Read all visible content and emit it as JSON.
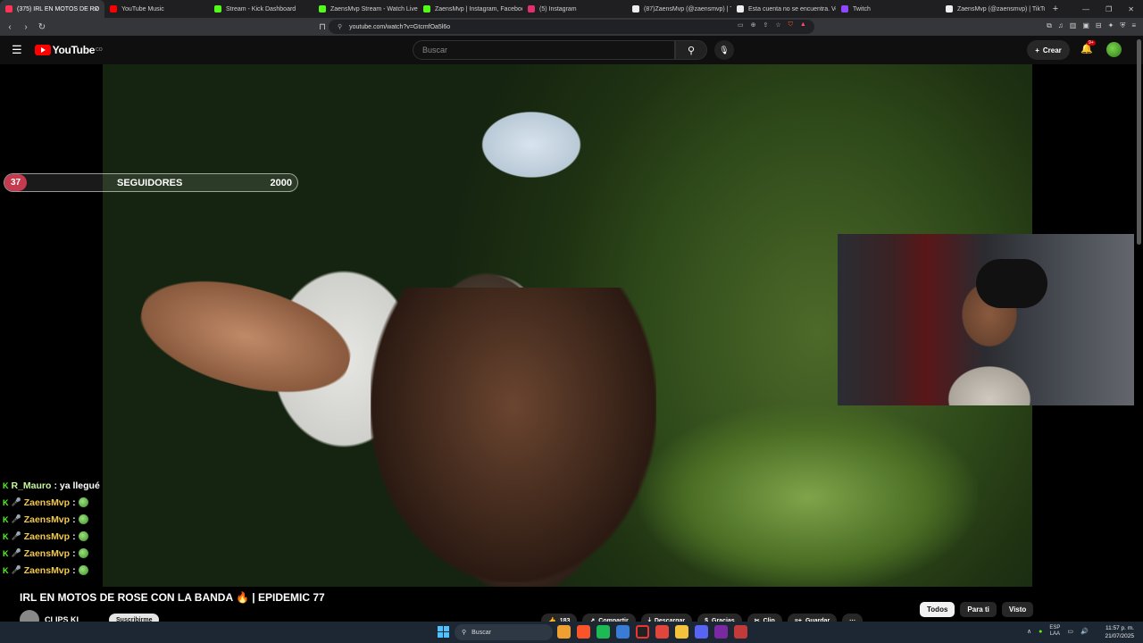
{
  "browser": {
    "tabs": [
      {
        "title": "(375) IRL EN MOTOS DE RO",
        "color": "#ff3355",
        "active": true
      },
      {
        "title": "YouTube Music",
        "color": "#ff0000"
      },
      {
        "title": "Stream - Kick Dashboard",
        "color": "#53fc18"
      },
      {
        "title": "ZaensMvp Stream - Watch Live on",
        "color": "#53fc18"
      },
      {
        "title": "ZaensMvp | Instagram, Facebook,",
        "color": "#53fc18"
      },
      {
        "title": "(5) Instagram",
        "color": "#e1306c"
      },
      {
        "title": "(87)ZaensMvp (@zaensmvp) | TikTo",
        "color": "#eeeeee"
      },
      {
        "title": "Esta cuenta no se encuentra. Ve a",
        "color": "#eeeeee"
      },
      {
        "title": "Twitch",
        "color": "#9146ff"
      },
      {
        "title": "ZaensMvp (@zaensmvp) | TikTok",
        "color": "#eeeeee"
      }
    ],
    "url": "youtube.com/watch?v=GtcmfOa5l6o"
  },
  "youtube": {
    "logo": "YouTube",
    "logo_sup": "CO",
    "search_placeholder": "Buscar",
    "create_label": "Crear",
    "notif_count": "9+"
  },
  "overlay": {
    "followers_count": "37",
    "followers_label": "SEGUIDORES",
    "followers_goal": "2000",
    "chat": [
      {
        "user": "R_Mauro",
        "msg": ": ya llegué",
        "style": "green",
        "emoji": false
      },
      {
        "user": "ZaensMvp",
        "msg": ":",
        "style": "gold",
        "emoji": true
      },
      {
        "user": "ZaensMvp",
        "msg": ":",
        "style": "gold",
        "emoji": true
      },
      {
        "user": "ZaensMvp",
        "msg": ":",
        "style": "gold",
        "emoji": true
      },
      {
        "user": "ZaensMvp",
        "msg": ":",
        "style": "gold",
        "emoji": true
      },
      {
        "user": "ZaensMvp",
        "msg": ":",
        "style": "gold",
        "emoji": true
      }
    ]
  },
  "video": {
    "title": "IRL EN MOTOS DE ROSE CON LA BANDA 🔥 | EPIDEMIC 77",
    "channel": "CLIPS KL",
    "subscribe_label": "Suscribirme",
    "likes": "183",
    "actions": [
      "Compartir",
      "Descargar",
      "Gracias",
      "Clip",
      "Guardar"
    ],
    "more": "···"
  },
  "chips": [
    "Todos",
    "Para ti",
    "Visto"
  ],
  "taskbar": {
    "search_placeholder": "Buscar",
    "lang_top": "ESP",
    "lang_bottom": "LAA",
    "time": "11:57 p. m.",
    "date": "21/07/2025"
  }
}
